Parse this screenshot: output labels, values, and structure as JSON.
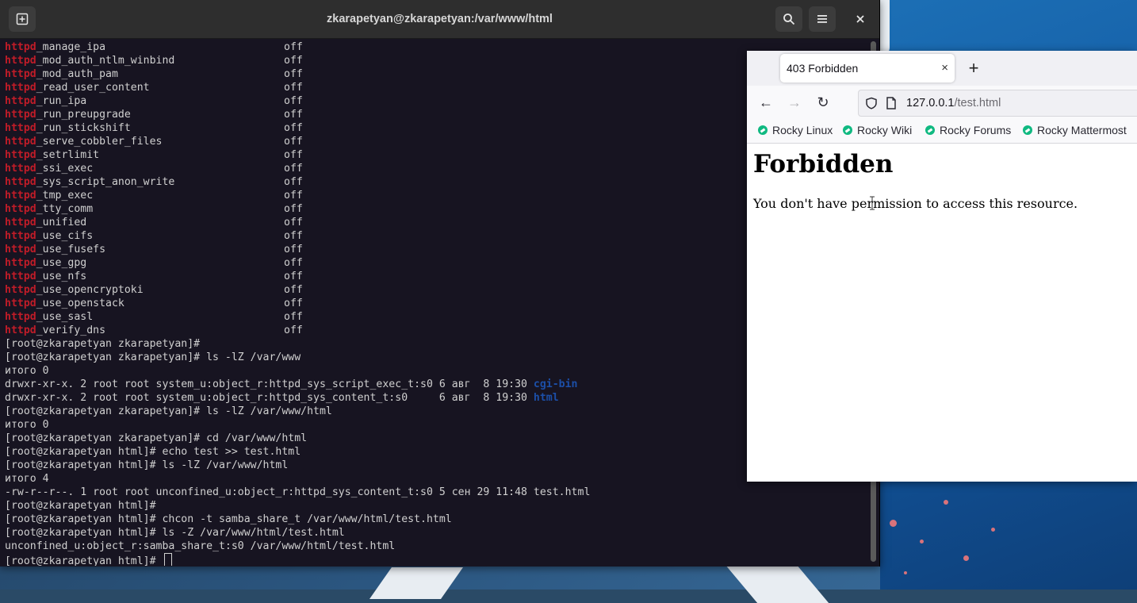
{
  "terminal": {
    "title": "zkarapetyan@zkarapetyan:/var/www/html",
    "new_tab_icon": "new-tab-icon",
    "search_icon": "search-icon",
    "menu_icon": "hamburger-menu-icon",
    "close_icon": "close-icon",
    "booleans": [
      {
        "prefix": "httpd",
        "name": "_manage_ipa",
        "state": "off"
      },
      {
        "prefix": "httpd",
        "name": "_mod_auth_ntlm_winbind",
        "state": "off"
      },
      {
        "prefix": "httpd",
        "name": "_mod_auth_pam",
        "state": "off"
      },
      {
        "prefix": "httpd",
        "name": "_read_user_content",
        "state": "off"
      },
      {
        "prefix": "httpd",
        "name": "_run_ipa",
        "state": "off"
      },
      {
        "prefix": "httpd",
        "name": "_run_preupgrade",
        "state": "off"
      },
      {
        "prefix": "httpd",
        "name": "_run_stickshift",
        "state": "off"
      },
      {
        "prefix": "httpd",
        "name": "_serve_cobbler_files",
        "state": "off"
      },
      {
        "prefix": "httpd",
        "name": "_setrlimit",
        "state": "off"
      },
      {
        "prefix": "httpd",
        "name": "_ssi_exec",
        "state": "off"
      },
      {
        "prefix": "httpd",
        "name": "_sys_script_anon_write",
        "state": "off"
      },
      {
        "prefix": "httpd",
        "name": "_tmp_exec",
        "state": "off"
      },
      {
        "prefix": "httpd",
        "name": "_tty_comm",
        "state": "off"
      },
      {
        "prefix": "httpd",
        "name": "_unified",
        "state": "off"
      },
      {
        "prefix": "httpd",
        "name": "_use_cifs",
        "state": "off"
      },
      {
        "prefix": "httpd",
        "name": "_use_fusefs",
        "state": "off"
      },
      {
        "prefix": "httpd",
        "name": "_use_gpg",
        "state": "off"
      },
      {
        "prefix": "httpd",
        "name": "_use_nfs",
        "state": "off"
      },
      {
        "prefix": "httpd",
        "name": "_use_opencryptoki",
        "state": "off"
      },
      {
        "prefix": "httpd",
        "name": "_use_openstack",
        "state": "off"
      },
      {
        "prefix": "httpd",
        "name": "_use_sasl",
        "state": "off"
      },
      {
        "prefix": "httpd",
        "name": "_verify_dns",
        "state": "off"
      }
    ],
    "lines": [
      {
        "text": "[root@zkarapetyan zkarapetyan]#"
      },
      {
        "text": "[root@zkarapetyan zkarapetyan]# ls -lZ /var/www"
      },
      {
        "text": "итого 0"
      },
      {
        "text": "drwxr-xr-x. 2 root root system_u:object_r:httpd_sys_script_exec_t:s0 6 авг  8 19:30 ",
        "dir": "cgi-bin"
      },
      {
        "text": "drwxr-xr-x. 2 root root system_u:object_r:httpd_sys_content_t:s0     6 авг  8 19:30 ",
        "dir": "html"
      },
      {
        "text": "[root@zkarapetyan zkarapetyan]# ls -lZ /var/www/html"
      },
      {
        "text": "итого 0"
      },
      {
        "text": "[root@zkarapetyan zkarapetyan]# cd /var/www/html"
      },
      {
        "text": "[root@zkarapetyan html]# echo test >> test.html"
      },
      {
        "text": "[root@zkarapetyan html]# ls -lZ /var/www/html"
      },
      {
        "text": "итого 4"
      },
      {
        "text": "-rw-r--r--. 1 root root unconfined_u:object_r:httpd_sys_content_t:s0 5 сен 29 11:48 test.html"
      },
      {
        "text": "[root@zkarapetyan html]#"
      },
      {
        "text": "[root@zkarapetyan html]# chcon -t samba_share_t /var/www/html/test.html"
      },
      {
        "text": "[root@zkarapetyan html]# ls -Z /var/www/html/test.html"
      },
      {
        "text": "unconfined_u:object_r:samba_share_t:s0 /var/www/html/test.html"
      }
    ],
    "prompt": "[root@zkarapetyan html]# "
  },
  "browser": {
    "tab_title": "403 Forbidden",
    "tab_close": "×",
    "new_tab": "+",
    "back": "←",
    "forward": "→",
    "reload": "↻",
    "url_host": "127.0.0.1",
    "url_path": "/test.html",
    "bookmarks": [
      "Rocky Linux",
      "Rocky Wiki",
      "Rocky Forums",
      "Rocky Mattermost"
    ],
    "page_heading": "Forbidden",
    "page_text": "You don't have permission to access this resource."
  },
  "colors": {
    "terminal_bg": "#171421",
    "highlight_red": "#c01c28",
    "dir_blue": "#1c4fa8",
    "bookmark_green": "#10b981"
  }
}
